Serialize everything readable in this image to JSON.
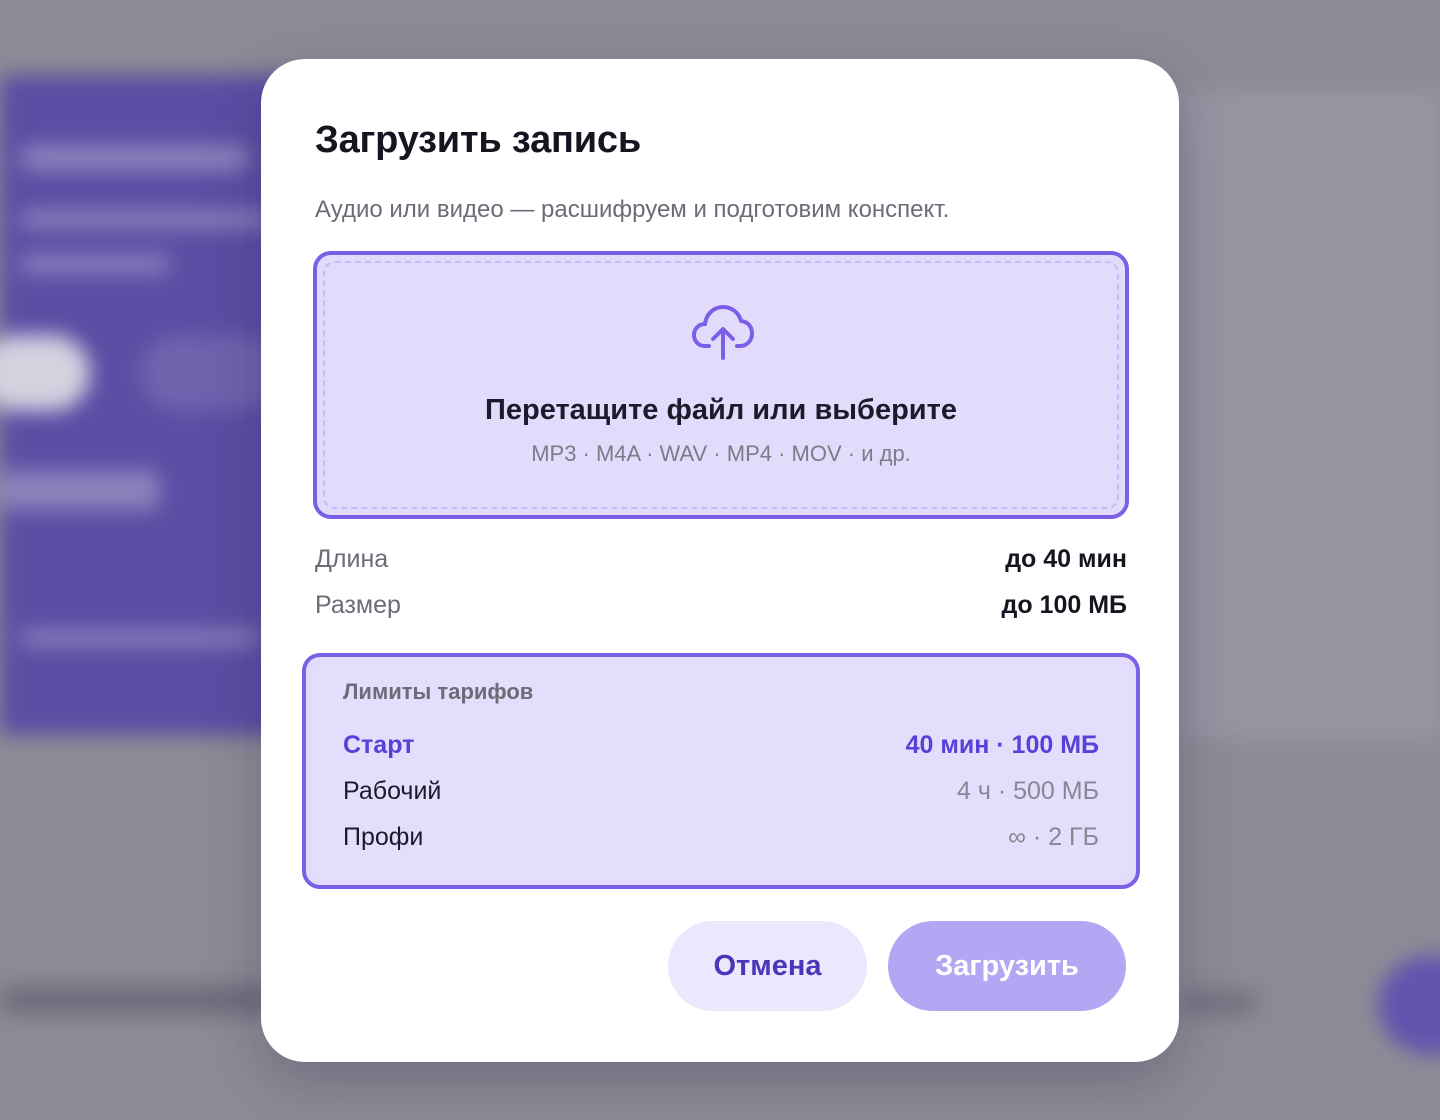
{
  "modal": {
    "title": "Загрузить запись",
    "subtitle": "Аудио или видео — расшифруем и подготовим конспект."
  },
  "dropzone": {
    "icon": "cloud-upload-icon",
    "title": "Перетащите файл или выберите",
    "formats": "MP3 · M4A · WAV · MP4 · MOV · и др."
  },
  "specs": [
    {
      "label": "Длина",
      "value": "до 40 мин"
    },
    {
      "label": "Размер",
      "value": "до 100 МБ"
    }
  ],
  "limits": {
    "title": "Лимиты тарифов",
    "plans": [
      {
        "name": "Старт",
        "value": "40 мин · 100 МБ",
        "active": true
      },
      {
        "name": "Рабочий",
        "value": "4 ч · 500 МБ",
        "active": false
      },
      {
        "name": "Профи",
        "value": "∞ · 2 ГБ",
        "active": false
      }
    ]
  },
  "buttons": {
    "cancel": "Отмена",
    "upload": "Загрузить"
  },
  "colors": {
    "accent": "#7a60e6",
    "accent_text": "#5a40d8",
    "dropzone_bg": "#e2dbfb",
    "upload_disabled": "#b3a6f3"
  }
}
